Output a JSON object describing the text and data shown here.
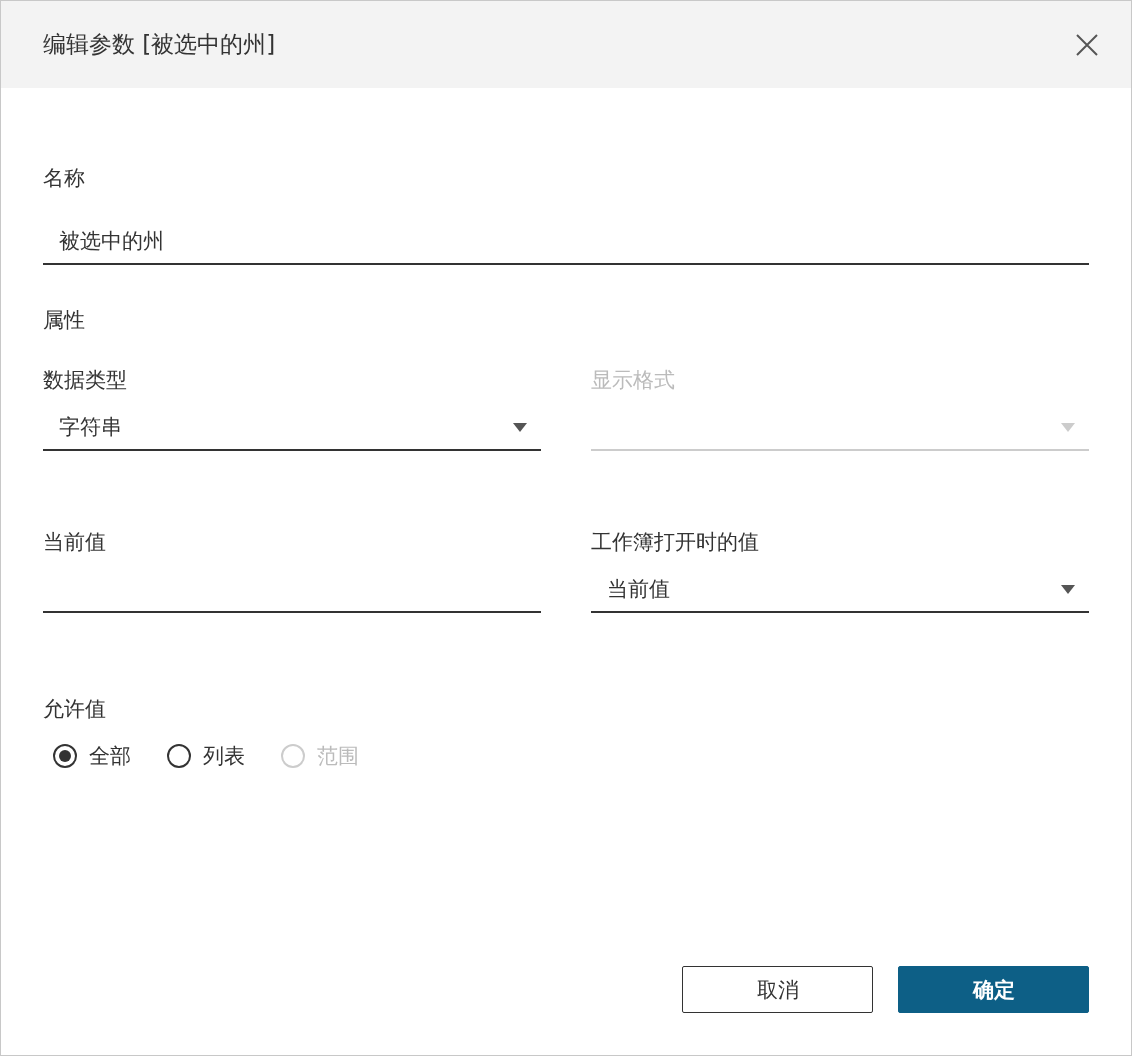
{
  "dialog": {
    "title": "编辑参数 [被选中的州]"
  },
  "name": {
    "label": "名称",
    "value": "被选中的州"
  },
  "properties": {
    "heading": "属性",
    "fields": [
      {
        "label": "数据类型",
        "value": "字符串",
        "kind": "dropdown",
        "disabled": false
      },
      {
        "label": "显示格式",
        "kind": "dropdown",
        "disabled": true
      },
      {
        "label": "当前值",
        "kind": "text",
        "disabled": false
      },
      {
        "label": "工作簿打开时的值",
        "value": "当前值",
        "kind": "dropdown",
        "disabled": false
      }
    ]
  },
  "allowed_values": {
    "label": "允许值",
    "options": [
      {
        "label": "全部",
        "selected": true,
        "disabled": false
      },
      {
        "label": "列表",
        "selected": false,
        "disabled": false
      },
      {
        "label": "范围",
        "selected": false,
        "disabled": true
      }
    ]
  },
  "buttons": [
    {
      "label": "取消",
      "kind": "secondary"
    },
    {
      "label": "确定",
      "kind": "primary"
    }
  ]
}
